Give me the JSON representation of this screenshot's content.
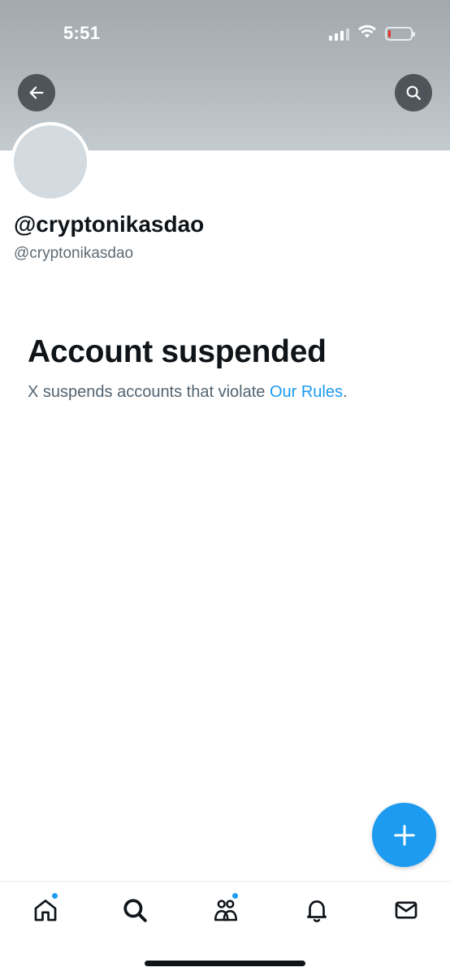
{
  "status_bar": {
    "time": "5:51",
    "signal_icon": "cellular-signal-icon",
    "wifi_icon": "wifi-icon",
    "battery_icon": "battery-low-icon",
    "battery_level": 0.08,
    "battery_color": "#e5332a"
  },
  "header": {
    "back_icon": "arrow-left-icon",
    "search_icon": "search-icon",
    "banner_color": "#b2babf"
  },
  "profile": {
    "display_name": "@cryptonikasdao",
    "handle": "@cryptonikasdao",
    "avatar_color": "#d3dbe0"
  },
  "notice": {
    "title": "Account suspended",
    "text_prefix": "X suspends accounts that violate ",
    "link_text": "Our Rules",
    "text_suffix": "."
  },
  "fab": {
    "icon": "plus-icon",
    "color": "#1d9bf0"
  },
  "bottom_nav": {
    "items": [
      {
        "icon": "home-icon",
        "has_badge": true
      },
      {
        "icon": "search-icon",
        "has_badge": false
      },
      {
        "icon": "communities-icon",
        "has_badge": true
      },
      {
        "icon": "bell-icon",
        "has_badge": false
      },
      {
        "icon": "mail-icon",
        "has_badge": false
      }
    ]
  },
  "colors": {
    "accent": "#1d9bf0",
    "text_primary": "#0f1419",
    "text_secondary": "#536471"
  }
}
